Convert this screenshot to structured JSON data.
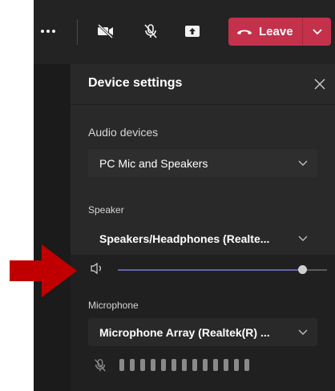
{
  "toolbar": {
    "more_icon": "more-options-icon",
    "camera_icon": "camera-off-icon",
    "mic_icon": "mic-off-icon",
    "share_icon": "share-screen-icon",
    "leave_label": "Leave",
    "leave_color": "#c4314b"
  },
  "panel": {
    "title": "Device settings",
    "audio_devices_label": "Audio devices",
    "audio_devices_value": "PC Mic and Speakers",
    "speaker_label": "Speaker",
    "speaker_value": "Speakers/Headphones (Realte...",
    "speaker_volume_percent": 88,
    "microphone_label": "Microphone",
    "microphone_value": "Microphone Array (Realtek(R) ...",
    "mic_meter_bars": 13,
    "accent_color": "#6264a7"
  },
  "annotation": {
    "arrow_color": "#c00000"
  }
}
